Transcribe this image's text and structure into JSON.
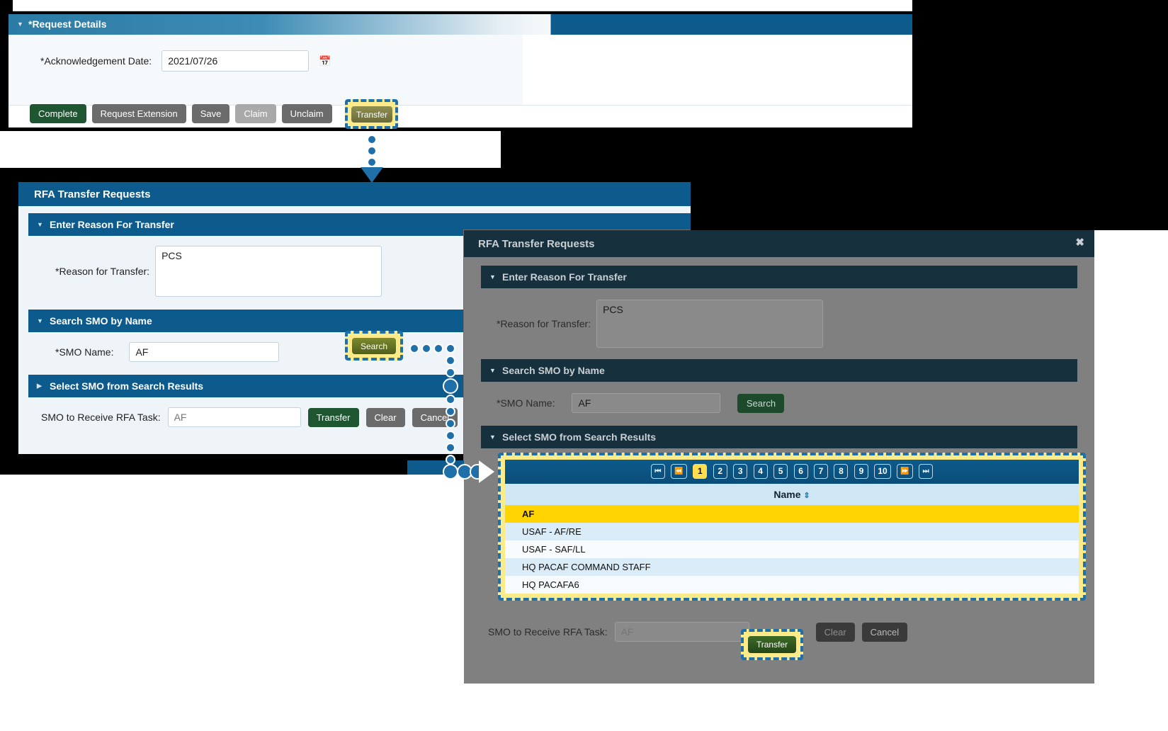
{
  "panel1": {
    "section_title": "*Request Details",
    "ack_label": "*Acknowledgement Date:",
    "ack_value": "2021/07/26",
    "calendar_icon": "calendar-icon",
    "buttons": [
      {
        "label": "Complete",
        "style": "green"
      },
      {
        "label": "Request Extension",
        "style": "grey"
      },
      {
        "label": "Save",
        "style": "grey"
      },
      {
        "label": "Claim",
        "style": "grey-disabled"
      },
      {
        "label": "Unclaim",
        "style": "grey"
      },
      {
        "label": "Transfer",
        "style": "grey",
        "highlighted": true
      }
    ]
  },
  "panel2": {
    "title": "RFA Transfer Requests",
    "close_label": "✖",
    "sections": {
      "reason": {
        "header": "Enter Reason For Transfer",
        "label": "*Reason for Transfer:",
        "value": "PCS"
      },
      "search": {
        "header": "Search SMO by Name",
        "label": "*SMO Name:",
        "value": "AF",
        "search_button": "Search"
      },
      "results": {
        "header": "Select SMO from Search Results"
      }
    },
    "footer": {
      "label": "SMO to Receive RFA Task:",
      "input_placeholder": "AF",
      "buttons": [
        {
          "label": "Transfer",
          "style": "green"
        },
        {
          "label": "Clear",
          "style": "grey"
        },
        {
          "label": "Cancel",
          "style": "grey"
        }
      ]
    }
  },
  "panel3": {
    "title": "RFA Transfer Requests",
    "close_label": "✖",
    "sections": {
      "reason": {
        "header": "Enter Reason For Transfer",
        "label": "*Reason for Transfer:",
        "value": "PCS"
      },
      "search": {
        "header": "Search SMO by Name",
        "label": "*SMO Name:",
        "value": "AF",
        "search_button": "Search"
      },
      "results": {
        "header": "Select SMO from Search Results",
        "pager": {
          "first": "⏮",
          "prev": "⏪",
          "pages": [
            "1",
            "2",
            "3",
            "4",
            "5",
            "6",
            "7",
            "8",
            "9",
            "10"
          ],
          "current_page": "1",
          "next": "⏩",
          "last": "⏭"
        },
        "column_header": "Name",
        "sort_icon": "sort-updown-icon",
        "rows": [
          {
            "name": "AF",
            "selected": true
          },
          {
            "name": "USAF - AF/RE",
            "selected": false
          },
          {
            "name": "USAF - SAF/LL",
            "selected": false
          },
          {
            "name": "HQ PACAF COMMAND STAFF",
            "selected": false
          },
          {
            "name": "HQ PACAFA6",
            "selected": false
          }
        ]
      }
    },
    "footer": {
      "label": "SMO to Receive RFA Task:",
      "input_placeholder": "AF",
      "buttons": [
        {
          "label": "Transfer",
          "style": "green",
          "highlighted": true
        },
        {
          "label": "Clear",
          "style": "grey-disabled"
        },
        {
          "label": "Cancel",
          "style": "grey"
        }
      ]
    }
  },
  "annotations": {
    "accent_highlight": "#fdeb8a",
    "accent_border": "#1f6fa8",
    "selected_row_color": "#ffd400"
  }
}
